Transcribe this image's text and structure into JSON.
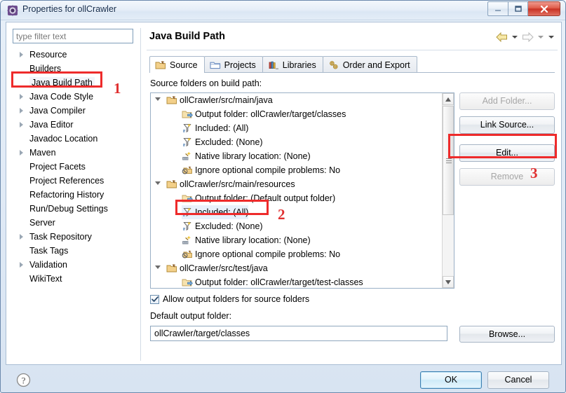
{
  "window": {
    "title": "Properties for ollCrawler",
    "icon": "eclipse-properties-icon",
    "minimize_label": "–",
    "maximize_label": "□",
    "close_label": "✕"
  },
  "sidebar": {
    "filter": {
      "placeholder": "type filter text",
      "value": ""
    },
    "items": [
      {
        "label": "Resource",
        "expandable": true,
        "selected": false
      },
      {
        "label": "Builders",
        "expandable": false,
        "selected": false
      },
      {
        "label": "Java Build Path",
        "expandable": false,
        "selected": true
      },
      {
        "label": "Java Code Style",
        "expandable": true,
        "selected": false
      },
      {
        "label": "Java Compiler",
        "expandable": true,
        "selected": false
      },
      {
        "label": "Java Editor",
        "expandable": true,
        "selected": false
      },
      {
        "label": "Javadoc Location",
        "expandable": false,
        "selected": false
      },
      {
        "label": "Maven",
        "expandable": true,
        "selected": false
      },
      {
        "label": "Project Facets",
        "expandable": false,
        "selected": false
      },
      {
        "label": "Project References",
        "expandable": false,
        "selected": false
      },
      {
        "label": "Refactoring History",
        "expandable": false,
        "selected": false
      },
      {
        "label": "Run/Debug Settings",
        "expandable": false,
        "selected": false
      },
      {
        "label": "Server",
        "expandable": false,
        "selected": false
      },
      {
        "label": "Task Repository",
        "expandable": true,
        "selected": false
      },
      {
        "label": "Task Tags",
        "expandable": false,
        "selected": false
      },
      {
        "label": "Validation",
        "expandable": true,
        "selected": false
      },
      {
        "label": "WikiText",
        "expandable": false,
        "selected": false
      }
    ]
  },
  "page": {
    "title": "Java Build Path",
    "nav": {
      "back_icon": "back-arrow-icon",
      "back_menu_icon": "chevron-down-icon",
      "forward_icon": "forward-arrow-icon",
      "forward_menu_icon": "chevron-down-icon",
      "view_menu_icon": "chevron-down-icon"
    },
    "tabs": [
      {
        "label": "Source",
        "icon": "source-folder-icon",
        "active": true
      },
      {
        "label": "Projects",
        "icon": "projects-icon",
        "active": false
      },
      {
        "label": "Libraries",
        "icon": "libraries-icon",
        "active": false
      },
      {
        "label": "Order and Export",
        "icon": "order-export-icon",
        "active": false
      }
    ],
    "source_label": "Source folders on build path:",
    "tree": [
      {
        "text": "ollCrawler/src/main/java",
        "indent": 0,
        "icon": "source-folder-icon",
        "expander": true,
        "highlight": false
      },
      {
        "text": "Output folder: ollCrawler/target/classes",
        "indent": 1,
        "icon": "output-folder-icon",
        "expander": false,
        "highlight": false
      },
      {
        "text": "Included: (All)",
        "indent": 1,
        "icon": "filter-icon",
        "expander": false,
        "highlight": false
      },
      {
        "text": "Excluded: (None)",
        "indent": 1,
        "icon": "filter-icon",
        "expander": false,
        "highlight": false
      },
      {
        "text": "Native library location: (None)",
        "indent": 1,
        "icon": "native-library-icon",
        "expander": false,
        "highlight": false
      },
      {
        "text": "Ignore optional compile problems: No",
        "indent": 1,
        "icon": "ignore-problems-icon",
        "expander": false,
        "highlight": false
      },
      {
        "text": "ollCrawler/src/main/resources",
        "indent": 0,
        "icon": "source-folder-icon",
        "expander": true,
        "highlight": false
      },
      {
        "text": "Output folder: (Default output folder)",
        "indent": 1,
        "icon": "output-folder-icon",
        "expander": false,
        "highlight": false
      },
      {
        "text": "Included: (All)",
        "indent": 1,
        "icon": "filter-icon",
        "expander": false,
        "highlight": true
      },
      {
        "text": "Excluded: (None)",
        "indent": 1,
        "icon": "filter-icon",
        "expander": false,
        "highlight": false
      },
      {
        "text": "Native library location: (None)",
        "indent": 1,
        "icon": "native-library-icon",
        "expander": false,
        "highlight": false
      },
      {
        "text": "Ignore optional compile problems: No",
        "indent": 1,
        "icon": "ignore-problems-icon",
        "expander": false,
        "highlight": false
      },
      {
        "text": "ollCrawler/src/test/java",
        "indent": 0,
        "icon": "source-folder-icon",
        "expander": true,
        "highlight": false
      },
      {
        "text": "Output folder: ollCrawler/target/test-classes",
        "indent": 1,
        "icon": "output-folder-icon",
        "expander": false,
        "highlight": false
      }
    ],
    "side_buttons": [
      {
        "label": "Add Folder...",
        "enabled": false
      },
      {
        "label": "Link Source...",
        "enabled": true
      },
      {
        "label": "Edit...",
        "enabled": true
      },
      {
        "label": "Remove",
        "enabled": false
      }
    ],
    "allow_output_folders": {
      "label": "Allow output folders for source folders",
      "checked": true,
      "check_glyph": "✓"
    },
    "default_output": {
      "label": "Default output folder:",
      "value": "ollCrawler/target/classes",
      "browse_label": "Browse..."
    }
  },
  "footer": {
    "help_icon": "help-question-icon",
    "ok_label": "OK",
    "cancel_label": "Cancel"
  },
  "annotations": [
    {
      "number": "1",
      "target": "Java Build Path sidebar item"
    },
    {
      "number": "2",
      "target": "Included: (All) tree row"
    },
    {
      "number": "3",
      "target": "Edit... button"
    }
  ],
  "colors": {
    "annotation_red": "#ee2b2b",
    "annotation_number": "#e03030",
    "title_text": "#11294a",
    "close_button": "#c93224",
    "ok_border": "#3c7fb1",
    "selection_blue": "#e8f1fb"
  }
}
